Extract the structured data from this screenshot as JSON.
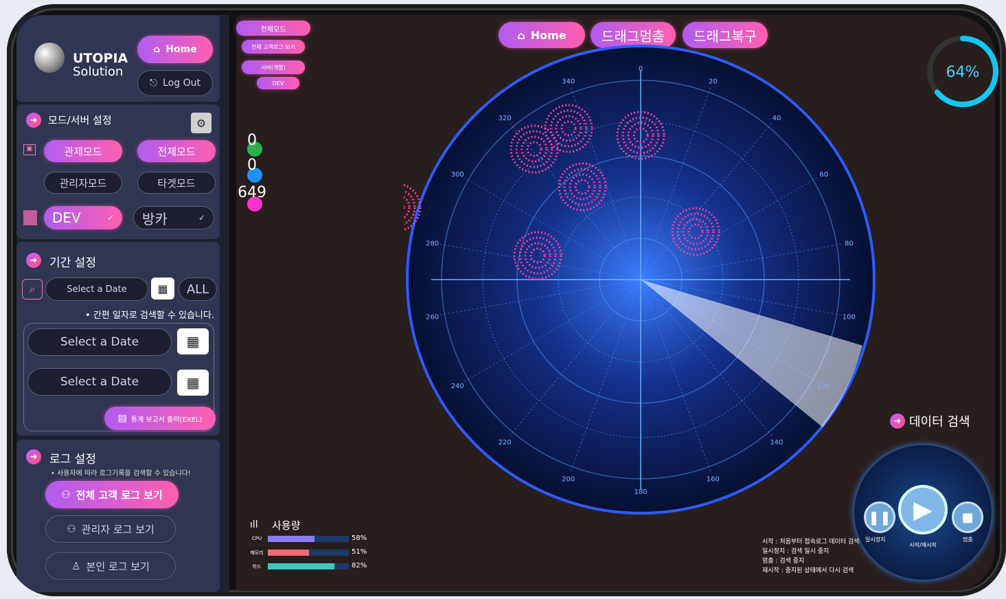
{
  "brand": {
    "name": "UTOPIA",
    "sub": "Solution"
  },
  "top_buttons": {
    "home": "Home",
    "logout": "Log Out"
  },
  "mode_panel": {
    "title": "모드/서버 설정",
    "control": "관제모드",
    "all": "전체모드",
    "admin": "관리자모드",
    "target": "타겟모드",
    "server": "DEV",
    "server2": "방카"
  },
  "period_panel": {
    "title": "기간 설정",
    "quick_placeholder": "Select a Date",
    "all": "ALL",
    "hint": "• 간편 일자로 검색할 수 있습니다.",
    "start": "Select a Date",
    "end": "Select a Date",
    "export": "통계 보고서 출력(EXEL)"
  },
  "log_panel": {
    "title": "로그 설정",
    "hint": "• 사용자에 따라 로그기록을 검색할 수 있습니다!",
    "all_customer": "전체 고객 로그 보기",
    "admin": "관리자 로그 보기",
    "self": "본인 로그 보기"
  },
  "breadcrumb": {
    "all_mode": "전체모드",
    "all_customer_log": "전체 고객로그 보기",
    "server_dev": "서버(개발)",
    "dev": "DEV"
  },
  "counters": {
    "green": "0",
    "blue": "0",
    "pink": "649"
  },
  "header_buttons": {
    "home": "Home",
    "drag_stop": "드래그멈춤",
    "drag_restore": "드래그복구"
  },
  "progress": {
    "value": 64,
    "label": "64%"
  },
  "data_search": "데이터 검색",
  "usage": {
    "title": "사용량",
    "rows": [
      {
        "label": "CPU",
        "value": 58,
        "text": "58%",
        "color": "#8a7cf0"
      },
      {
        "label": "메모리",
        "value": 51,
        "text": "51%",
        "color": "#f06a7a"
      },
      {
        "label": "하드",
        "value": 82,
        "text": "82%",
        "color": "#3ec8b8"
      }
    ]
  },
  "controls": {
    "pause": "일시정지",
    "play": "시작/재시작",
    "stop": "멈춤"
  },
  "legend": [
    "시작 : 처음부터 접속로그 데이터 검색",
    "일시정지 : 검색 일시 중지",
    "멈춤 : 검색 중지",
    "재시작 : 중지된 상태에서 다시 검색"
  ],
  "radar_labels": [
    "0",
    "20",
    "40",
    "60",
    "80",
    "100",
    "120",
    "140",
    "160",
    "180",
    "200",
    "220",
    "240",
    "260",
    "280",
    "300",
    "320",
    "340"
  ]
}
